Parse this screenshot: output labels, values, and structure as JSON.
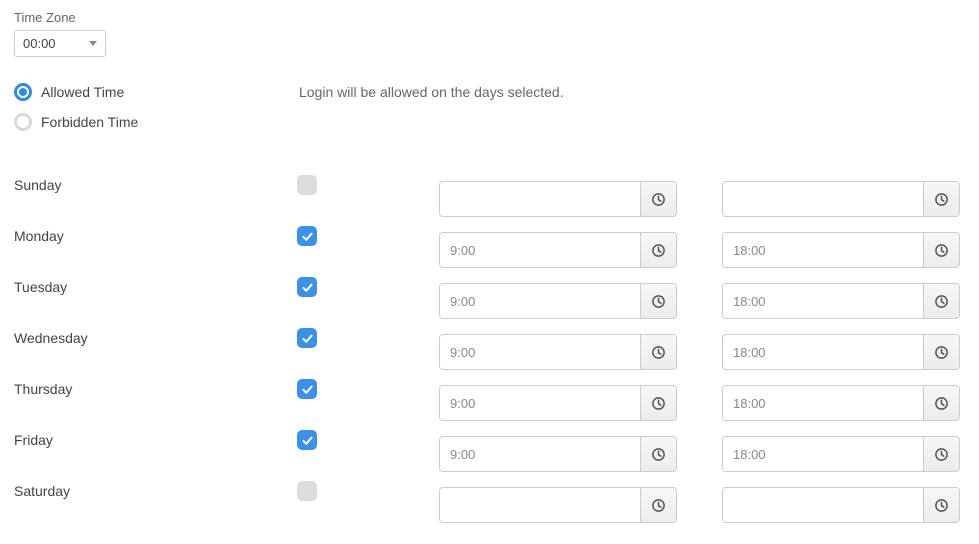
{
  "timezone": {
    "label": "Time Zone",
    "value": "00:00"
  },
  "mode": {
    "allowed_label": "Allowed Time",
    "forbidden_label": "Forbidden Time",
    "selected": "allowed",
    "description": "Login will be allowed on the days selected."
  },
  "days": [
    {
      "name": "Sunday",
      "checked": false,
      "start": "",
      "end": ""
    },
    {
      "name": "Monday",
      "checked": true,
      "start": "9:00",
      "end": "18:00"
    },
    {
      "name": "Tuesday",
      "checked": true,
      "start": "9:00",
      "end": "18:00"
    },
    {
      "name": "Wednesday",
      "checked": true,
      "start": "9:00",
      "end": "18:00"
    },
    {
      "name": "Thursday",
      "checked": true,
      "start": "9:00",
      "end": "18:00"
    },
    {
      "name": "Friday",
      "checked": true,
      "start": "9:00",
      "end": "18:00"
    },
    {
      "name": "Saturday",
      "checked": false,
      "start": "",
      "end": ""
    }
  ]
}
